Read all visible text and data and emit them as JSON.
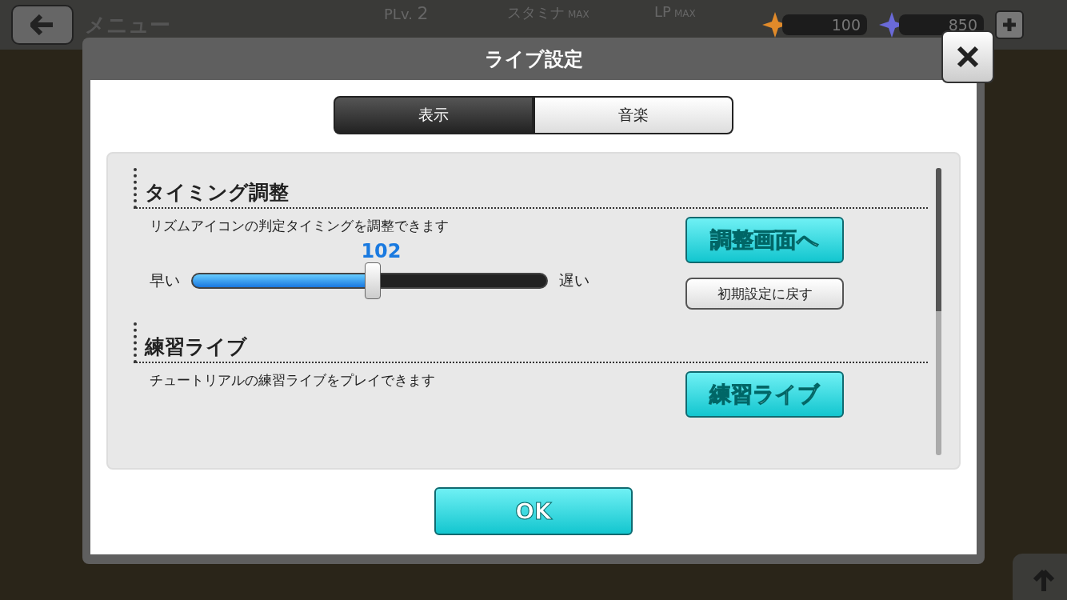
{
  "header": {
    "title": "メニュー",
    "level": {
      "label": "PLv.",
      "value": "2"
    },
    "stamina": {
      "label": "スタミナ",
      "badge": "MAX"
    },
    "lp": {
      "label": "LP",
      "badge": "MAX"
    },
    "currencies": [
      {
        "kind": "p",
        "value": "100"
      },
      {
        "kind": "m",
        "value": "850"
      }
    ]
  },
  "dialog": {
    "title": "ライブ設定",
    "tabs": [
      {
        "label": "表示",
        "selected": true
      },
      {
        "label": "音楽",
        "selected": false
      }
    ],
    "sections": [
      {
        "heading": "タイミング調整",
        "description": "リズムアイコンの判定タイミングを調整できます",
        "kind": "slider",
        "slider": {
          "value_label": "102",
          "level": 0.51,
          "min_label": "早い",
          "max_label": "遅い"
        },
        "buttons": [
          {
            "label": "調整画面へ",
            "kind": "primary"
          },
          {
            "label": "初期設定に戻す",
            "kind": "secondary"
          }
        ]
      },
      {
        "heading": "練習ライブ",
        "description": "チュートリアルの練習ライブをプレイできます",
        "kind": "plain",
        "buttons": [
          {
            "label": "練習ライブ",
            "kind": "primary"
          }
        ]
      }
    ],
    "ok_button": "OK"
  }
}
